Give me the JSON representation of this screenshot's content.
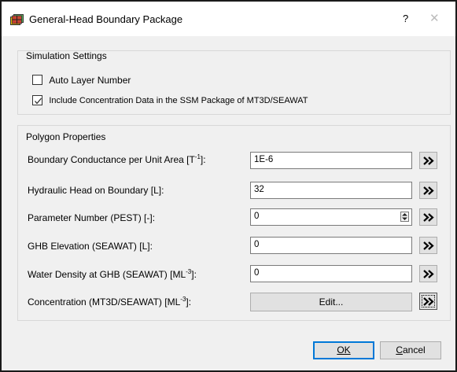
{
  "window": {
    "title": "General-Head Boundary Package",
    "help_label": "?",
    "close_label": "✕"
  },
  "simulation_settings": {
    "title": "Simulation Settings",
    "auto_layer": {
      "label": "Auto Layer Number",
      "checked": false
    },
    "include_conc": {
      "label": "Include Concentration Data in the SSM Package of MT3D/SEAWAT",
      "checked": true
    }
  },
  "polygon_properties": {
    "title": "Polygon Properties",
    "conductance": {
      "label_pre": "Boundary Conductance per Unit Area [T",
      "label_sup": "-1",
      "label_post": "]:",
      "value": "1E-6"
    },
    "head": {
      "label": "Hydraulic Head on Boundary  [L]:",
      "value": "32"
    },
    "param": {
      "label": "Parameter Number (PEST) [-]:",
      "value": "0"
    },
    "elevation": {
      "label": "GHB Elevation (SEAWAT) [L]:",
      "value": "0"
    },
    "density": {
      "label_pre": "Water Density at GHB (SEAWAT) [ML",
      "label_sup": "-3",
      "label_post": "]:",
      "value": "0"
    },
    "concentration": {
      "label_pre": "Concentration (MT3D/SEAWAT) [ML",
      "label_sup": "-3",
      "label_post": "]:",
      "button": "Edit..."
    }
  },
  "buttons": {
    "ok": "OK",
    "cancel": "Cancel"
  }
}
